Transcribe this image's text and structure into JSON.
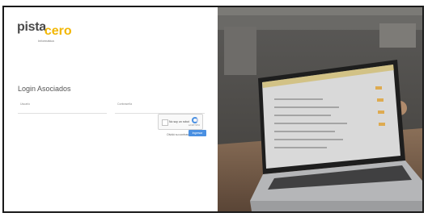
{
  "brand": {
    "word1": "pista",
    "word2": "cero",
    "tagline": "Informática"
  },
  "login": {
    "title": "Login Asociados",
    "user_label": "Usuario",
    "password_label": "Contraseña",
    "captcha_label": "No soy un robot",
    "captcha_brand": "reCAPTCHA",
    "forgot_label": "Olvidó su contraseña",
    "submit_label": "Ingresar"
  },
  "colors": {
    "accent": "#f2b705",
    "button": "#4a90e2"
  }
}
